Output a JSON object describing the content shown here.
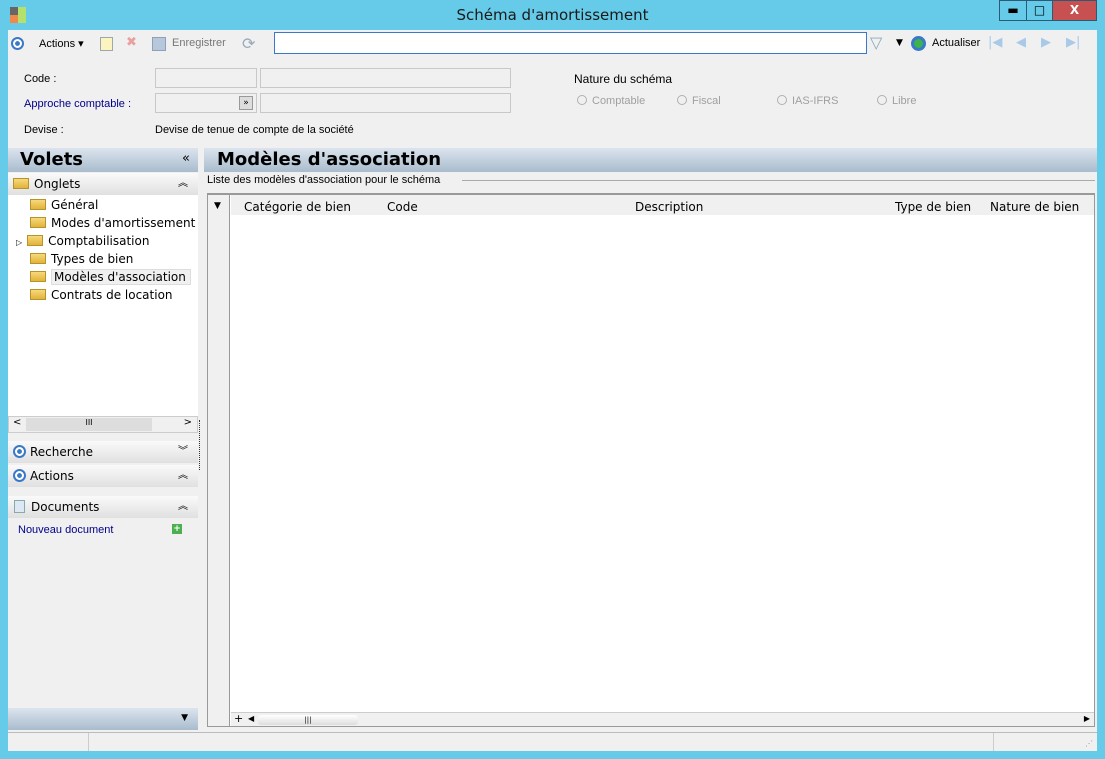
{
  "window": {
    "title": "Schéma d'amortissement",
    "minimize": "▬",
    "maximize": "□",
    "close": "X"
  },
  "toolbar": {
    "actions_label": "Actions",
    "save_label": "Enregistrer",
    "search_value": "",
    "refresh_label": "Actualiser"
  },
  "form": {
    "code_label": "Code :",
    "code_value": "",
    "code_desc": "",
    "approach_label": "Approche comptable :",
    "approach_value": "",
    "approach_desc": "",
    "currency_label": "Devise :",
    "currency_value": "Devise de tenue de compte de la société",
    "nature_label": "Nature du schéma",
    "nature_options": [
      "Comptable",
      "Fiscal",
      "IAS-IFRS",
      "Libre"
    ],
    "nature_selected": null
  },
  "sidebar": {
    "title": "Volets",
    "tabs_section": "Onglets",
    "items": [
      {
        "label": "Général"
      },
      {
        "label": "Modes d'amortissement app"
      },
      {
        "label": "Comptabilisation"
      },
      {
        "label": "Types de bien"
      },
      {
        "label": "Modèles d'association"
      },
      {
        "label": "Contrats de location"
      }
    ],
    "selected": "Modèles d'association",
    "search_section": "Recherche",
    "actions_section": "Actions",
    "documents_section": "Documents",
    "new_document": "Nouveau document"
  },
  "main": {
    "title": "Modèles d'association",
    "group_label": "Liste des modèles d'association pour le schéma",
    "columns": [
      "Catégorie de bien",
      "Code",
      "Description",
      "Type de bien",
      "Nature de bien"
    ],
    "rows": []
  },
  "colors": {
    "titlebar": "#65cbe8",
    "close": "#c75050",
    "link": "#00008b"
  }
}
